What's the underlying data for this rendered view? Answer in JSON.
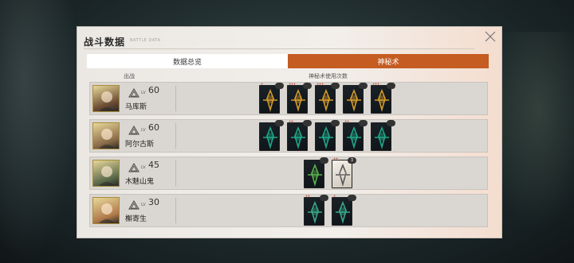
{
  "panel": {
    "title": "战斗数据",
    "subtitle": "BATTLE DATA"
  },
  "tabs": [
    {
      "label": "数据总览",
      "active": false
    },
    {
      "label": "神秘术",
      "active": true
    }
  ],
  "columns": {
    "deployed": "出战",
    "arcana_count": "神秘术使用次数"
  },
  "lv_label": "LV",
  "characters": [
    {
      "name": "马库斯",
      "level": "60",
      "portrait_color": "#6a4a32",
      "cards": [
        {
          "theme": "#d39a2a",
          "stars": "✦",
          "badge": ""
        },
        {
          "theme": "#d39a2a",
          "stars": "✦✦✦",
          "badge": ""
        },
        {
          "theme": "#d39a2a",
          "stars": "✦✦✦",
          "badge": ""
        },
        {
          "theme": "#d39a2a",
          "stars": "",
          "badge": ""
        },
        {
          "theme": "#d39a2a",
          "stars": "✦✦✦",
          "badge": ""
        }
      ]
    },
    {
      "name": "阿尔古斯",
      "level": "60",
      "portrait_color": "#8a6a48",
      "cards": [
        {
          "theme": "#1fa889",
          "stars": "",
          "badge": ""
        },
        {
          "theme": "#1fa889",
          "stars": "✦✦",
          "badge": ""
        },
        {
          "theme": "#1fa889",
          "stars": "",
          "badge": ""
        },
        {
          "theme": "#1fa889",
          "stars": "✦✦",
          "badge": ""
        },
        {
          "theme": "#1fa889",
          "stars": "",
          "badge": ""
        }
      ]
    },
    {
      "name": "木魅山鬼",
      "level": "45",
      "portrait_color": "#5a6a4a",
      "cards": [
        {
          "theme": "#5ab04a",
          "stars": "",
          "badge": ""
        },
        {
          "theme": "#e8e2d8",
          "stars": "✦✦",
          "badge": "3"
        }
      ]
    },
    {
      "name": "槲寄生",
      "level": "30",
      "portrait_color": "#b07a4a",
      "cards": [
        {
          "theme": "#3aa888",
          "stars": "✦✦",
          "badge": ""
        },
        {
          "theme": "#3aa888",
          "stars": "✦",
          "badge": ""
        }
      ]
    }
  ]
}
